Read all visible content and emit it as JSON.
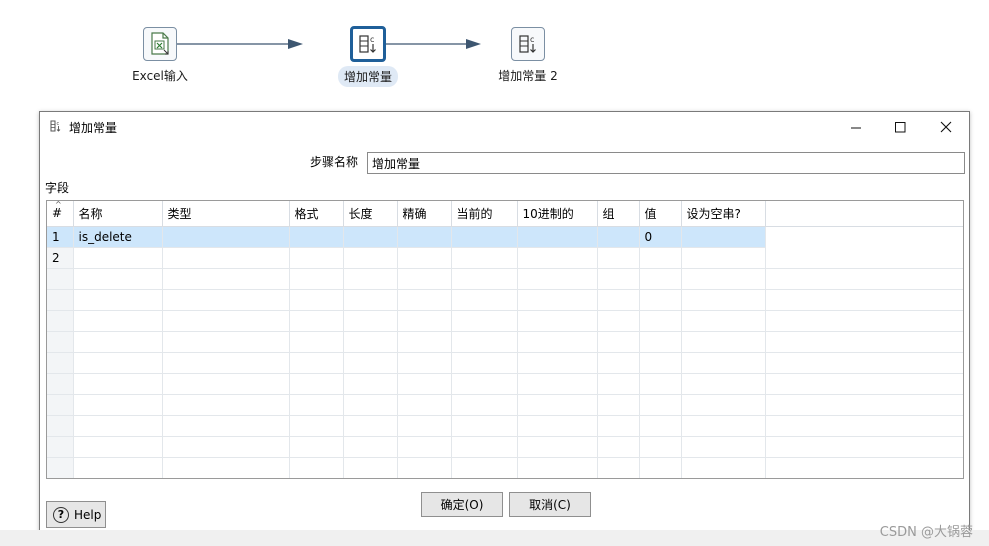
{
  "workflow": {
    "steps": [
      {
        "label": "Excel输入",
        "icon": "excel-icon"
      },
      {
        "label": "增加常量",
        "icon": "add-constants-icon",
        "selected": true
      },
      {
        "label": "增加常量 2",
        "icon": "add-constants-icon"
      }
    ]
  },
  "dialog": {
    "title": "增加常量",
    "step_name_label": "步骤名称",
    "step_name_value": "增加常量",
    "fields_label": "字段",
    "columns": [
      "#",
      "名称",
      "类型",
      "格式",
      "长度",
      "精确",
      "当前的",
      "10进制的",
      "组",
      "值",
      "设为空串?"
    ],
    "rows": [
      {
        "num": "1",
        "name": "is_delete",
        "type": "",
        "format": "",
        "length": "",
        "precision": "",
        "currency": "",
        "decimal": "",
        "group": "",
        "value": "0",
        "set_empty": "",
        "selected": true
      },
      {
        "num": "2",
        "name": "",
        "type": "",
        "format": "",
        "length": "",
        "precision": "",
        "currency": "",
        "decimal": "",
        "group": "",
        "value": "",
        "set_empty": ""
      }
    ],
    "ok_label": "确定(O)",
    "cancel_label": "取消(C)",
    "help_label": "Help",
    "accent_color": "#1f5f99",
    "selection_color": "#cde6fb"
  },
  "watermark": "CSDN @大锅蓉"
}
